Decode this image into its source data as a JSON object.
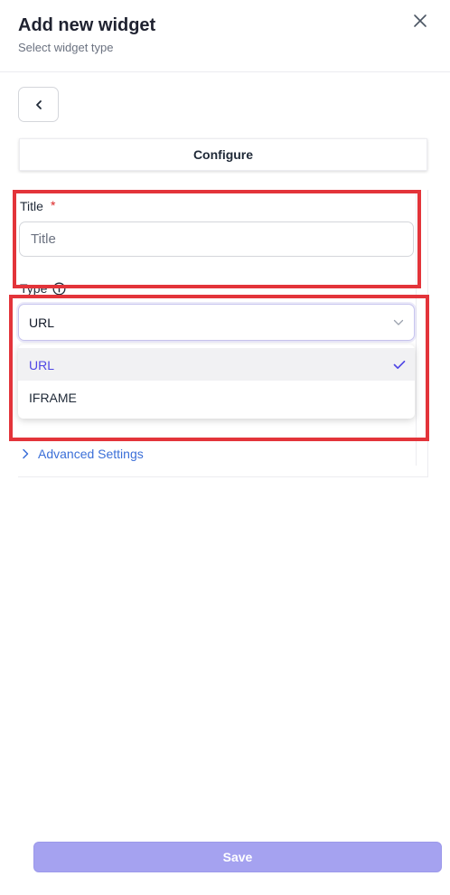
{
  "header": {
    "title": "Add new widget",
    "subtitle": "Select widget type",
    "close_icon": "close-icon"
  },
  "back_button": {
    "icon": "chevron-left-icon"
  },
  "configure_tab": {
    "label": "Configure"
  },
  "form": {
    "title_field": {
      "label": "Title",
      "required_mark": "*",
      "placeholder": "Title",
      "value": ""
    },
    "type_field": {
      "label": "Type",
      "info_icon": "info-circle-icon",
      "selected_value": "URL",
      "chevron_icon": "chevron-down-icon",
      "options": [
        {
          "label": "URL",
          "selected": true
        },
        {
          "label": "IFRAME",
          "selected": false
        }
      ]
    },
    "advanced_settings": {
      "label": "Advanced Settings",
      "icon": "chevron-right-icon"
    }
  },
  "footer": {
    "save_label": "Save"
  },
  "colors": {
    "accent": "#4f46e5",
    "link": "#3b6fd8",
    "save_button": "#a5a2f0",
    "highlight": "#e3343a",
    "required": "#dc2626"
  }
}
